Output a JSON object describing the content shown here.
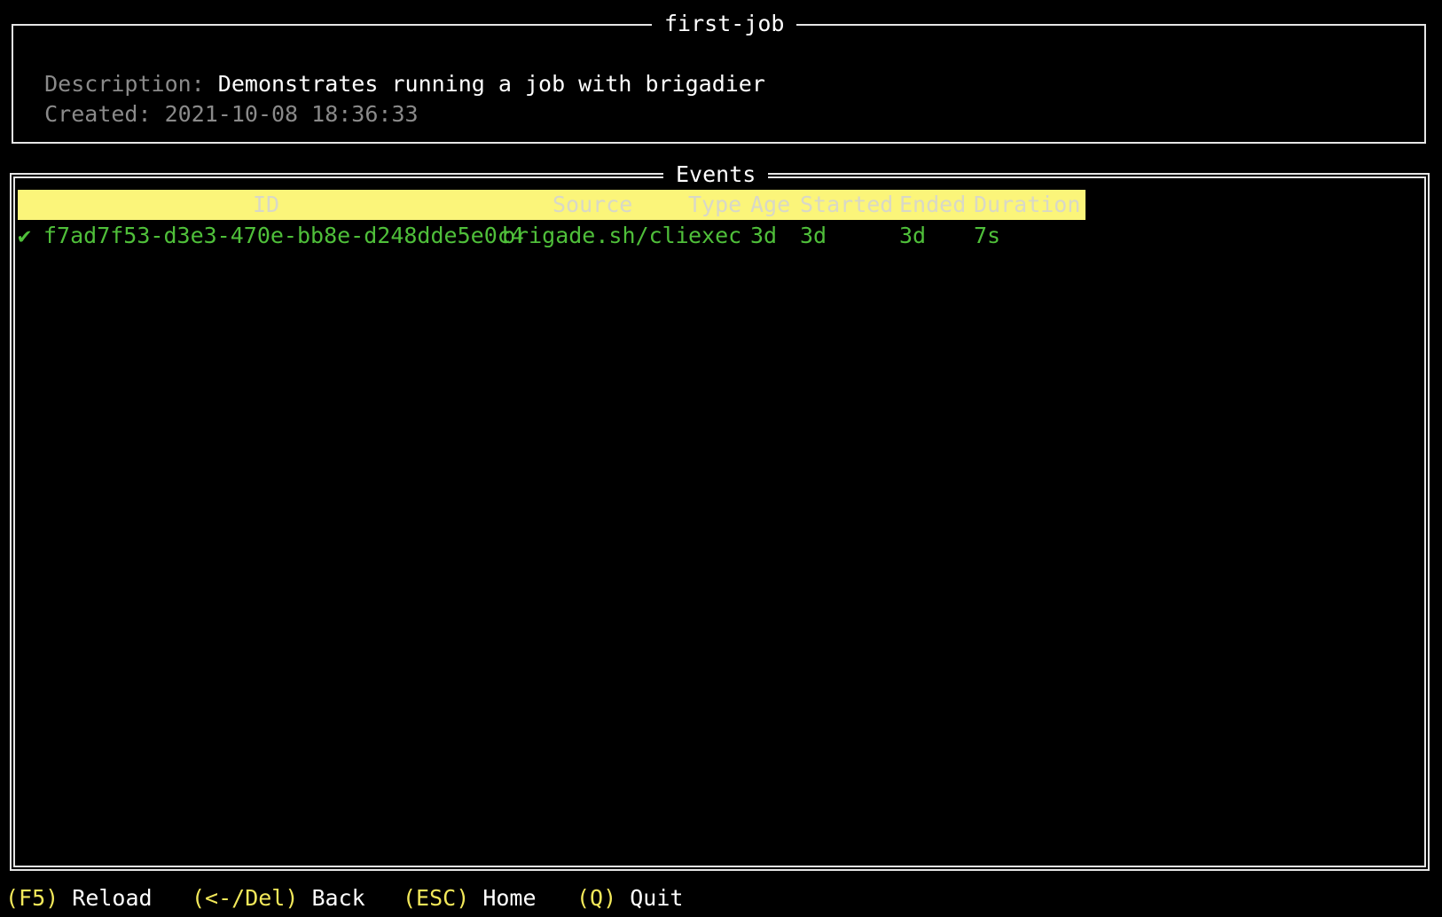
{
  "project": {
    "title": "first-job",
    "description_label": "Description:",
    "description": "Demonstrates running a job with brigadier",
    "created_label": "Created:",
    "created": "2021-10-08 18:36:33"
  },
  "events": {
    "panel_title": "Events",
    "columns": [
      "ID",
      "Source",
      "Type",
      "Age",
      "Started",
      "Ended",
      "Duration"
    ],
    "rows": [
      {
        "status_icon": "✔",
        "id": "f7ad7f53-d3e3-470e-bb8e-d248dde5e0c4",
        "source": "brigade.sh/cli",
        "type": "exec",
        "age": "3d",
        "started": "3d",
        "ended": "3d",
        "duration": "7s"
      }
    ]
  },
  "footer": {
    "items": [
      {
        "key": "(F5)",
        "label": "Reload"
      },
      {
        "key": "(<-/Del)",
        "label": "Back"
      },
      {
        "key": "(ESC)",
        "label": "Home"
      },
      {
        "key": "(Q)",
        "label": "Quit"
      }
    ]
  },
  "colors": {
    "header_bg": "#fbf57a",
    "row_text": "#4fbf3a",
    "footer_key": "#f2e85a",
    "dim_text": "#8a8a8a"
  }
}
